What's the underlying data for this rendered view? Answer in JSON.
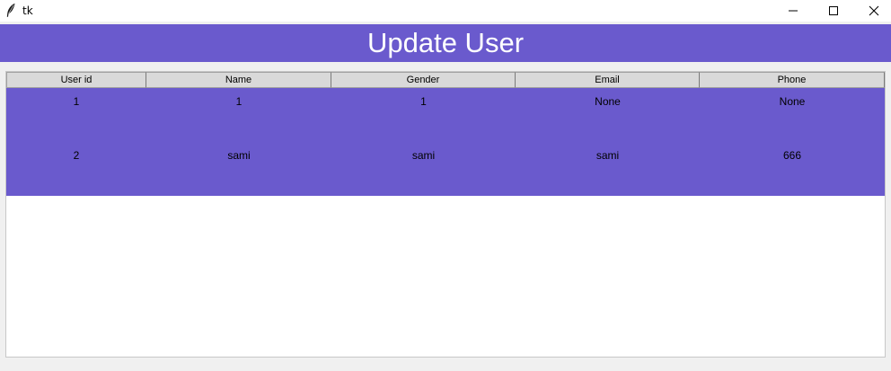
{
  "window": {
    "title": "tk",
    "controls": [
      "minimize-icon",
      "maximize-icon",
      "close-icon"
    ]
  },
  "banner": {
    "title": "Update User",
    "background": "#6a5acd",
    "text_color": "#ffffff"
  },
  "table": {
    "columns": [
      "User id",
      "Name",
      "Gender",
      "Email",
      "Phone"
    ],
    "rows": [
      [
        "1",
        "1",
        "1",
        "None",
        "None"
      ],
      [
        "2",
        "sami",
        "sami",
        "sami",
        "666"
      ]
    ],
    "row_background": "#6a5acd"
  }
}
